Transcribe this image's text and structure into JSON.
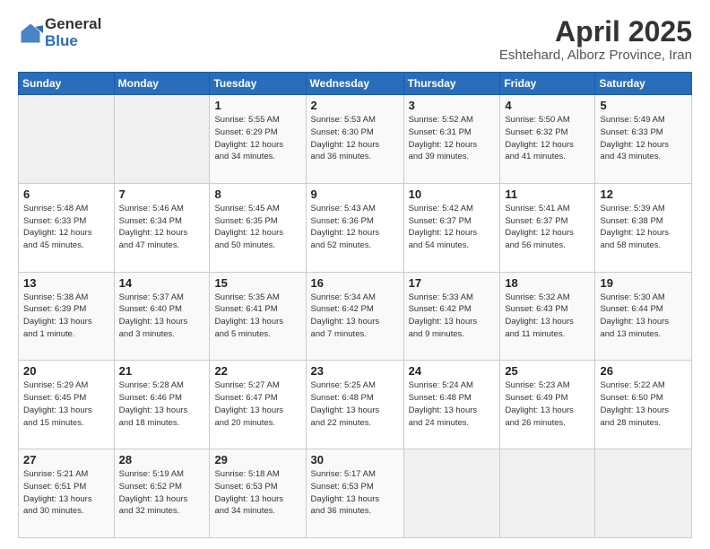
{
  "logo": {
    "general": "General",
    "blue": "Blue"
  },
  "title": "April 2025",
  "subtitle": "Eshtehard, Alborz Province, Iran",
  "headers": [
    "Sunday",
    "Monday",
    "Tuesday",
    "Wednesday",
    "Thursday",
    "Friday",
    "Saturday"
  ],
  "weeks": [
    [
      {
        "num": "",
        "info": ""
      },
      {
        "num": "",
        "info": ""
      },
      {
        "num": "1",
        "info": "Sunrise: 5:55 AM\nSunset: 6:29 PM\nDaylight: 12 hours\nand 34 minutes."
      },
      {
        "num": "2",
        "info": "Sunrise: 5:53 AM\nSunset: 6:30 PM\nDaylight: 12 hours\nand 36 minutes."
      },
      {
        "num": "3",
        "info": "Sunrise: 5:52 AM\nSunset: 6:31 PM\nDaylight: 12 hours\nand 39 minutes."
      },
      {
        "num": "4",
        "info": "Sunrise: 5:50 AM\nSunset: 6:32 PM\nDaylight: 12 hours\nand 41 minutes."
      },
      {
        "num": "5",
        "info": "Sunrise: 5:49 AM\nSunset: 6:33 PM\nDaylight: 12 hours\nand 43 minutes."
      }
    ],
    [
      {
        "num": "6",
        "info": "Sunrise: 5:48 AM\nSunset: 6:33 PM\nDaylight: 12 hours\nand 45 minutes."
      },
      {
        "num": "7",
        "info": "Sunrise: 5:46 AM\nSunset: 6:34 PM\nDaylight: 12 hours\nand 47 minutes."
      },
      {
        "num": "8",
        "info": "Sunrise: 5:45 AM\nSunset: 6:35 PM\nDaylight: 12 hours\nand 50 minutes."
      },
      {
        "num": "9",
        "info": "Sunrise: 5:43 AM\nSunset: 6:36 PM\nDaylight: 12 hours\nand 52 minutes."
      },
      {
        "num": "10",
        "info": "Sunrise: 5:42 AM\nSunset: 6:37 PM\nDaylight: 12 hours\nand 54 minutes."
      },
      {
        "num": "11",
        "info": "Sunrise: 5:41 AM\nSunset: 6:37 PM\nDaylight: 12 hours\nand 56 minutes."
      },
      {
        "num": "12",
        "info": "Sunrise: 5:39 AM\nSunset: 6:38 PM\nDaylight: 12 hours\nand 58 minutes."
      }
    ],
    [
      {
        "num": "13",
        "info": "Sunrise: 5:38 AM\nSunset: 6:39 PM\nDaylight: 13 hours\nand 1 minute."
      },
      {
        "num": "14",
        "info": "Sunrise: 5:37 AM\nSunset: 6:40 PM\nDaylight: 13 hours\nand 3 minutes."
      },
      {
        "num": "15",
        "info": "Sunrise: 5:35 AM\nSunset: 6:41 PM\nDaylight: 13 hours\nand 5 minutes."
      },
      {
        "num": "16",
        "info": "Sunrise: 5:34 AM\nSunset: 6:42 PM\nDaylight: 13 hours\nand 7 minutes."
      },
      {
        "num": "17",
        "info": "Sunrise: 5:33 AM\nSunset: 6:42 PM\nDaylight: 13 hours\nand 9 minutes."
      },
      {
        "num": "18",
        "info": "Sunrise: 5:32 AM\nSunset: 6:43 PM\nDaylight: 13 hours\nand 11 minutes."
      },
      {
        "num": "19",
        "info": "Sunrise: 5:30 AM\nSunset: 6:44 PM\nDaylight: 13 hours\nand 13 minutes."
      }
    ],
    [
      {
        "num": "20",
        "info": "Sunrise: 5:29 AM\nSunset: 6:45 PM\nDaylight: 13 hours\nand 15 minutes."
      },
      {
        "num": "21",
        "info": "Sunrise: 5:28 AM\nSunset: 6:46 PM\nDaylight: 13 hours\nand 18 minutes."
      },
      {
        "num": "22",
        "info": "Sunrise: 5:27 AM\nSunset: 6:47 PM\nDaylight: 13 hours\nand 20 minutes."
      },
      {
        "num": "23",
        "info": "Sunrise: 5:25 AM\nSunset: 6:48 PM\nDaylight: 13 hours\nand 22 minutes."
      },
      {
        "num": "24",
        "info": "Sunrise: 5:24 AM\nSunset: 6:48 PM\nDaylight: 13 hours\nand 24 minutes."
      },
      {
        "num": "25",
        "info": "Sunrise: 5:23 AM\nSunset: 6:49 PM\nDaylight: 13 hours\nand 26 minutes."
      },
      {
        "num": "26",
        "info": "Sunrise: 5:22 AM\nSunset: 6:50 PM\nDaylight: 13 hours\nand 28 minutes."
      }
    ],
    [
      {
        "num": "27",
        "info": "Sunrise: 5:21 AM\nSunset: 6:51 PM\nDaylight: 13 hours\nand 30 minutes."
      },
      {
        "num": "28",
        "info": "Sunrise: 5:19 AM\nSunset: 6:52 PM\nDaylight: 13 hours\nand 32 minutes."
      },
      {
        "num": "29",
        "info": "Sunrise: 5:18 AM\nSunset: 6:53 PM\nDaylight: 13 hours\nand 34 minutes."
      },
      {
        "num": "30",
        "info": "Sunrise: 5:17 AM\nSunset: 6:53 PM\nDaylight: 13 hours\nand 36 minutes."
      },
      {
        "num": "",
        "info": ""
      },
      {
        "num": "",
        "info": ""
      },
      {
        "num": "",
        "info": ""
      }
    ]
  ]
}
